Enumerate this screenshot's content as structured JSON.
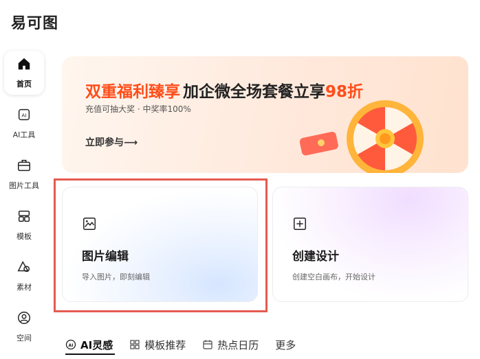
{
  "app": {
    "logo_text": "易可图"
  },
  "sidebar": {
    "items": [
      {
        "label": "首页",
        "icon": "home-icon"
      },
      {
        "label": "AI工具",
        "icon": "ai-icon"
      },
      {
        "label": "图片工具",
        "icon": "toolbox-icon"
      },
      {
        "label": "模板",
        "icon": "template-icon"
      },
      {
        "label": "素材",
        "icon": "shapes-icon"
      },
      {
        "label": "空间",
        "icon": "user-icon"
      }
    ]
  },
  "banner": {
    "title_part1": "双重福利臻享",
    "title_part2": "加企微全场套餐立享",
    "title_part3": "98折",
    "subtitle": "充值可抽大奖 · 中奖率100%",
    "cta": "立即参与⟶"
  },
  "cards": [
    {
      "title": "图片编辑",
      "subtitle": "导入图片，即刻编辑",
      "icon": "image-edit-icon"
    },
    {
      "title": "创建设计",
      "subtitle": "创建空白画布，开始设计",
      "icon": "plus-square-icon"
    }
  ],
  "tabs": [
    {
      "label": "AI灵感",
      "icon": "ai-spark-icon"
    },
    {
      "label": "模板推荐",
      "icon": "grid-icon"
    },
    {
      "label": "热点日历",
      "icon": "calendar-icon"
    },
    {
      "label": "更多"
    }
  ],
  "colors": {
    "accent": "#ff4d1a",
    "highlight": "#e45a4f"
  }
}
